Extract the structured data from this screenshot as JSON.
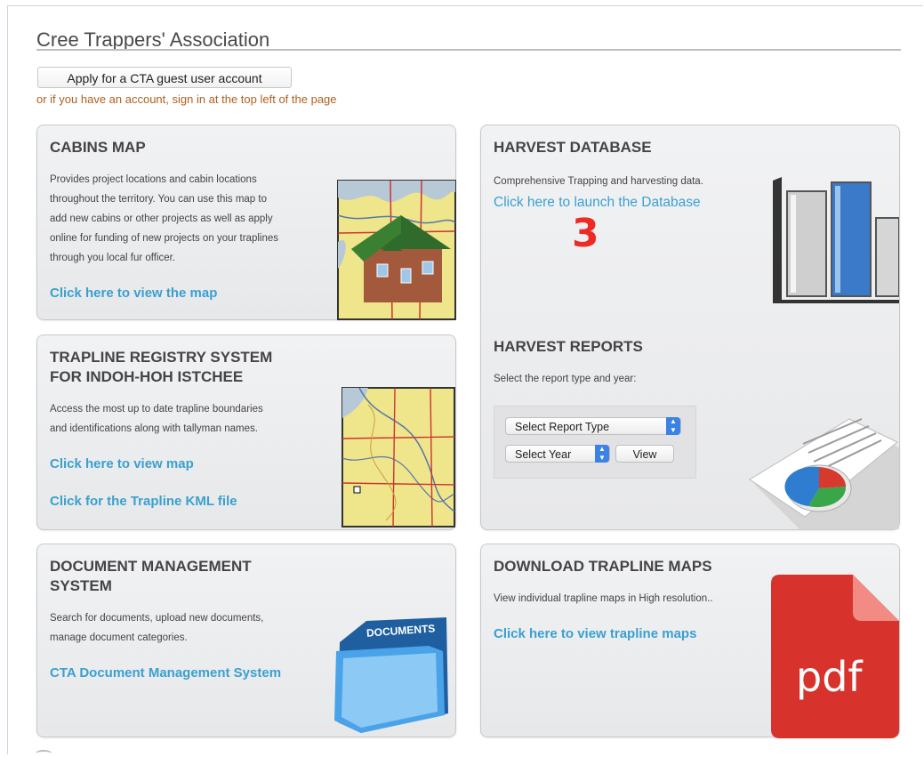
{
  "header": {
    "title": "Cree Trappers' Association",
    "guest_button": "Apply for a CTA guest user account",
    "signin_note": "or if you have an account, sign in at the top left of the page"
  },
  "cabins": {
    "heading": "CABINS MAP",
    "desc": [
      "Provides project locations and cabin locations",
      "throughout the territory. You can use this map to",
      "add new cabins or other projects as well as apply",
      "online for funding of new projects on your traplines",
      "through you local fur officer."
    ],
    "link": "Click here to view the map"
  },
  "trapline": {
    "heading": [
      "TRAPLINE REGISTRY SYSTEM",
      "FOR INDOH-HOH ISTCHEE"
    ],
    "desc": [
      "Access the most up to date trapline boundaries",
      "and identifications along with tallyman names."
    ],
    "link_map": "Click here to view map",
    "link_kml": "Click for the Trapline KML file"
  },
  "documents": {
    "heading": [
      "DOCUMENT MANAGEMENT",
      "SYSTEM"
    ],
    "desc": [
      "Search for documents, upload new documents,",
      "manage document categories."
    ],
    "link": "CTA Document Management System",
    "folder_label": "DOCUMENTS"
  },
  "harvest_db": {
    "heading": "HARVEST DATABASE",
    "desc": "Comprehensive Trapping and harvesting data.",
    "link": "Click here to launch the Database",
    "marker": "3"
  },
  "harvest_reports": {
    "heading": "HARVEST REPORTS",
    "desc": "Select the report type and year:",
    "report_type": "Select Report Type",
    "year": "Select Year",
    "view_button": "View"
  },
  "download": {
    "heading": "DOWNLOAD TRAPLINE MAPS",
    "desc": "View individual trapline maps in High resolution..",
    "link": "Click here to view trapline maps",
    "pdf_label": "pdf"
  },
  "colors": {
    "link": "#3aa0cf",
    "note": "#b06020",
    "marker": "#ee2a24",
    "pdf": "#d8322c"
  }
}
